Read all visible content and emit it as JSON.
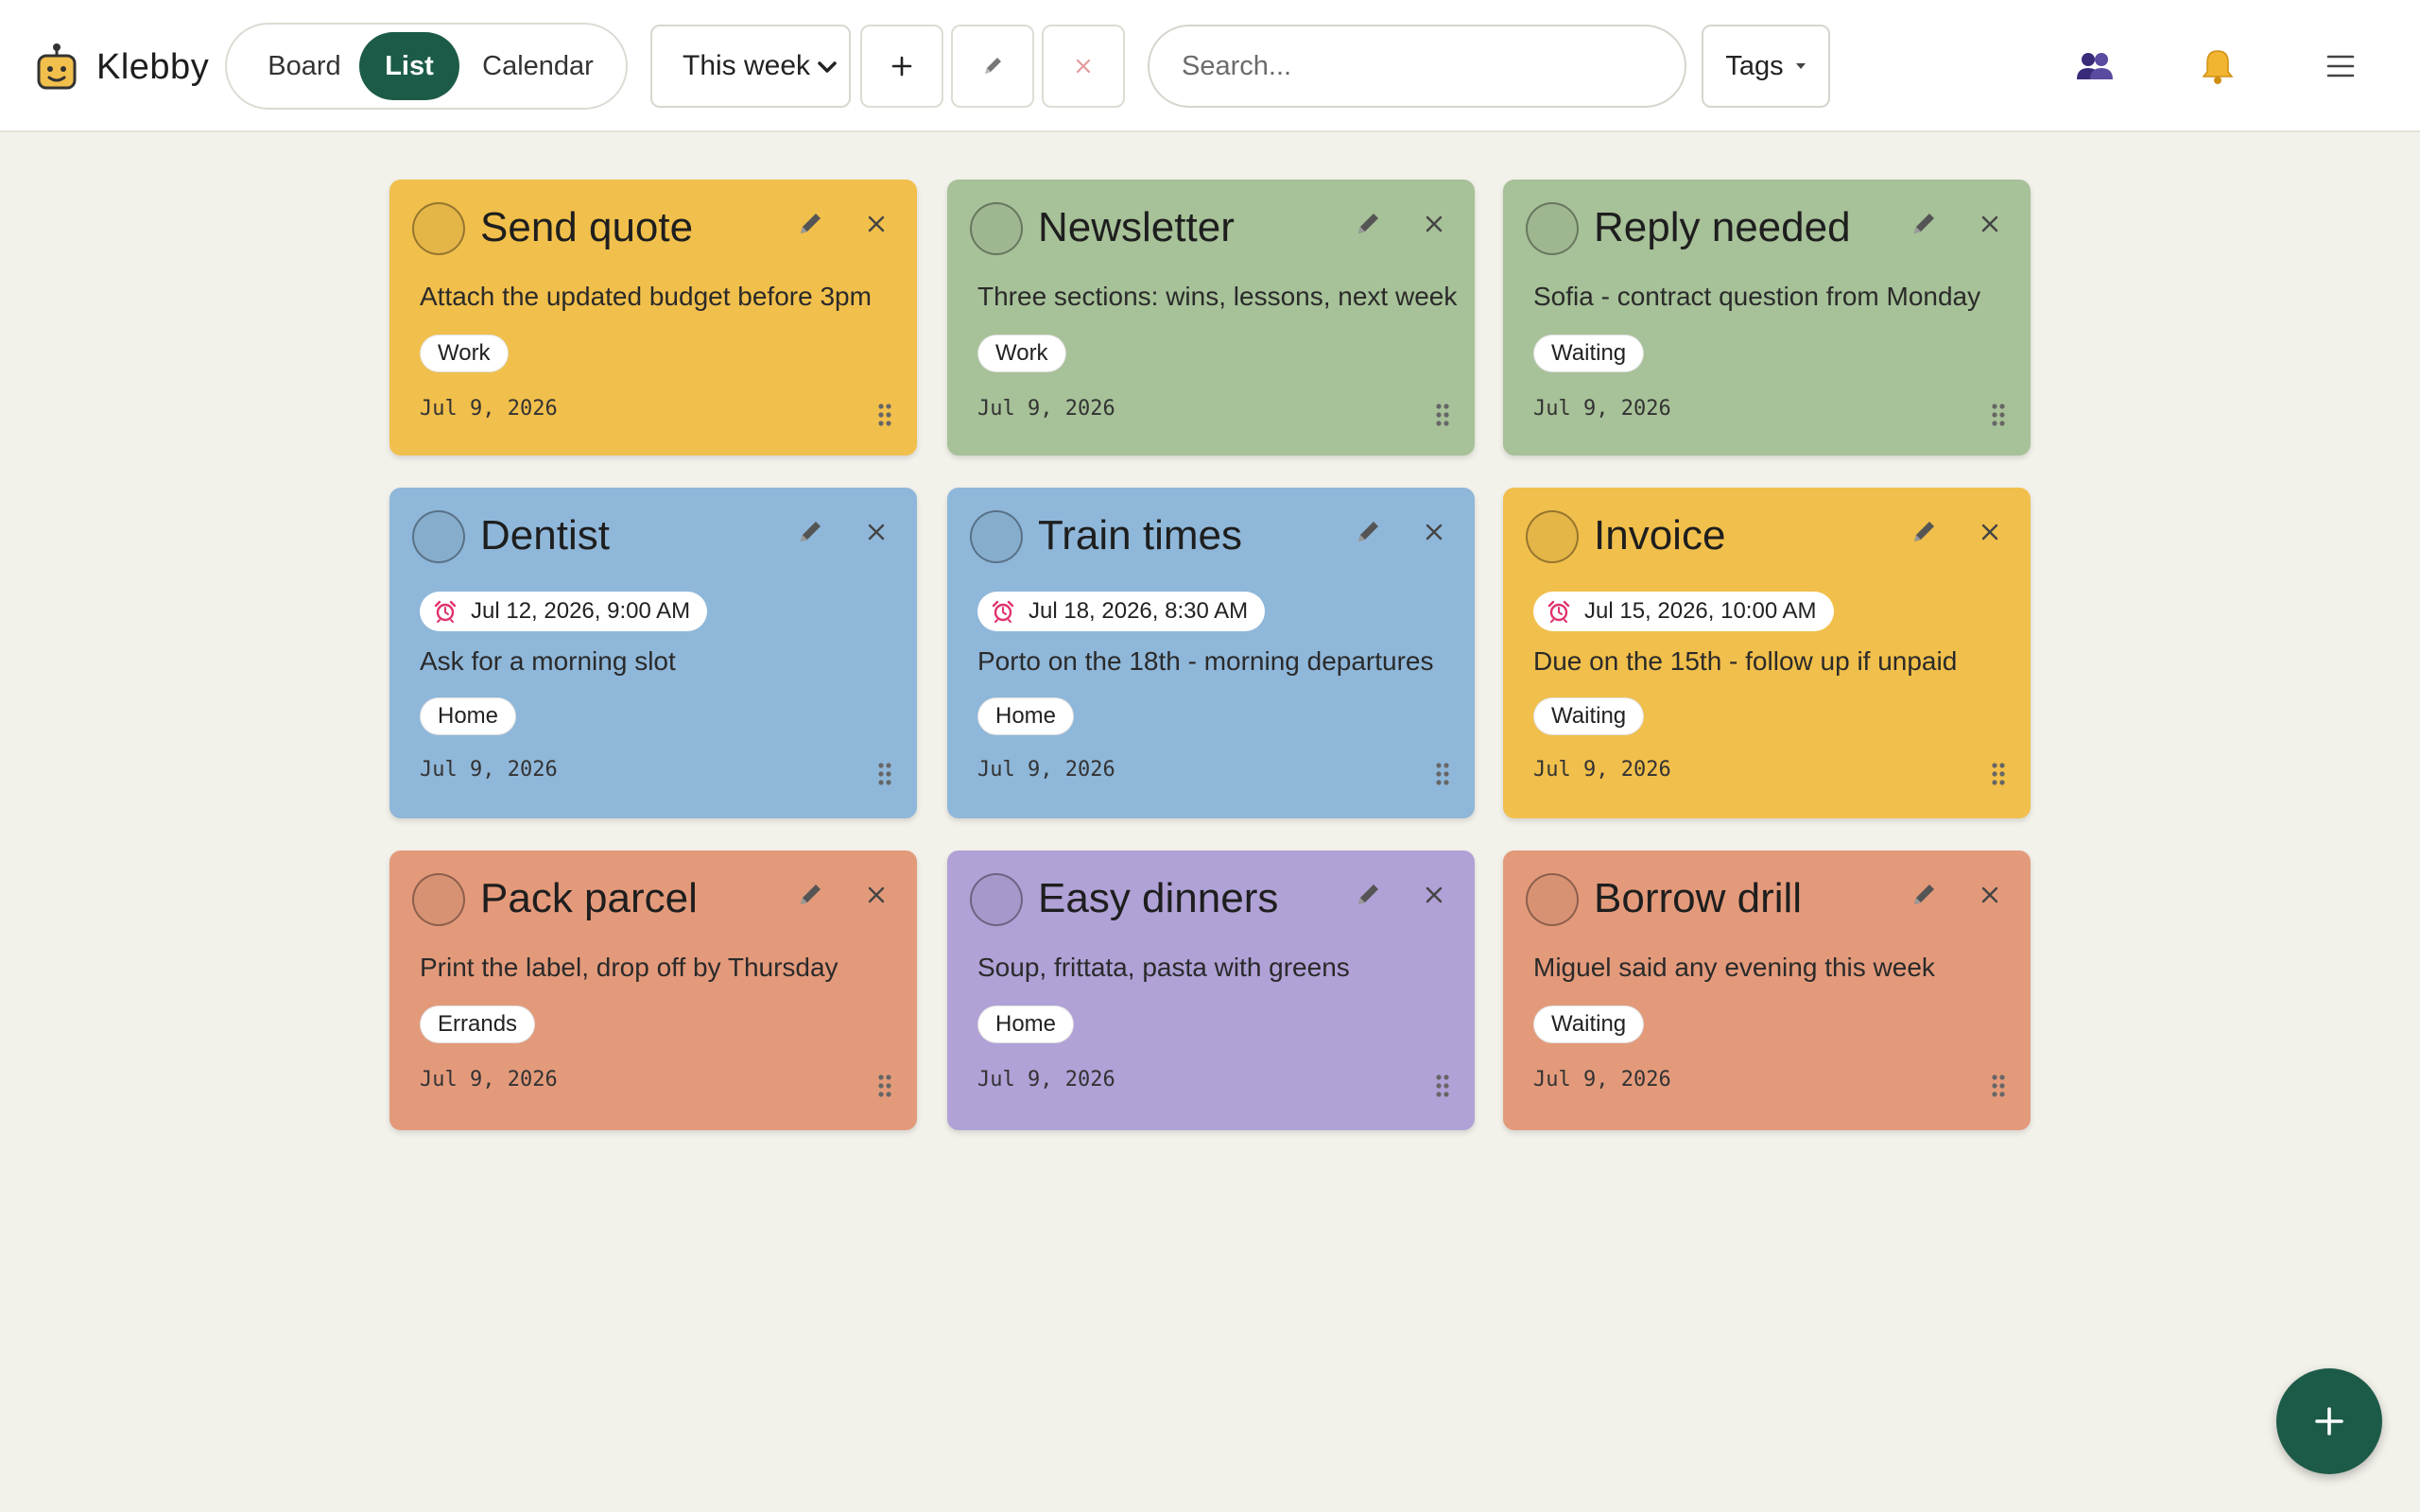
{
  "app": {
    "name": "Klebby",
    "logo_icon": "robot-logo-icon"
  },
  "header": {
    "views": [
      {
        "label": "Board",
        "active": false
      },
      {
        "label": "List",
        "active": true
      },
      {
        "label": "Calendar",
        "active": false
      }
    ],
    "range_select": {
      "value": "This week",
      "options": [
        "This week"
      ]
    },
    "add_button_label": "+",
    "search": {
      "placeholder": "Search...",
      "value": ""
    },
    "tags_button_label": "Tags",
    "icons": [
      "add-icon",
      "pencil-icon",
      "close-icon",
      "people-icon",
      "bell-icon",
      "menu-icon"
    ]
  },
  "colors": {
    "accent": "#1d5b49",
    "yellow": "#f1bf4b",
    "green": "#a7c198",
    "blue": "#8fb7d9",
    "orange": "#e39a7b",
    "purple": "#b0a1d6",
    "background": "#f2f1ea"
  },
  "cards": [
    {
      "title": "Send quote",
      "color": "yellow",
      "reminder": "",
      "description": "Attach the updated budget before 3pm",
      "tag": "Work",
      "date": "Jul 9, 2026"
    },
    {
      "title": "Newsletter",
      "color": "green",
      "reminder": "",
      "description": "Three sections: wins, lessons, next week",
      "tag": "Work",
      "date": "Jul 9, 2026"
    },
    {
      "title": "Reply needed",
      "color": "green",
      "reminder": "",
      "description": "Sofia - contract question from Monday",
      "tag": "Waiting",
      "date": "Jul 9, 2026"
    },
    {
      "title": "Dentist",
      "color": "blue",
      "reminder": "Jul 12, 2026, 9:00 AM",
      "description": "Ask for a morning slot",
      "tag": "Home",
      "date": "Jul 9, 2026"
    },
    {
      "title": "Train times",
      "color": "blue",
      "reminder": "Jul 18, 2026, 8:30 AM",
      "description": "Porto on the 18th - morning departures",
      "tag": "Home",
      "date": "Jul 9, 2026"
    },
    {
      "title": "Invoice",
      "color": "yellow",
      "reminder": "Jul 15, 2026, 10:00 AM",
      "description": "Due on the 15th - follow up if unpaid",
      "tag": "Waiting",
      "date": "Jul 9, 2026"
    },
    {
      "title": "Pack parcel",
      "color": "orange",
      "reminder": "",
      "description": "Print the label, drop off by Thursday",
      "tag": "Errands",
      "date": "Jul 9, 2026"
    },
    {
      "title": "Easy dinners",
      "color": "purple",
      "reminder": "",
      "description": "Soup, frittata, pasta with greens",
      "tag": "Home",
      "date": "Jul 9, 2026"
    },
    {
      "title": "Borrow drill",
      "color": "orange",
      "reminder": "",
      "description": "Miguel said any evening this week",
      "tag": "Waiting",
      "date": "Jul 9, 2026"
    }
  ],
  "fab": {
    "label": "+",
    "icon": "add-icon"
  }
}
